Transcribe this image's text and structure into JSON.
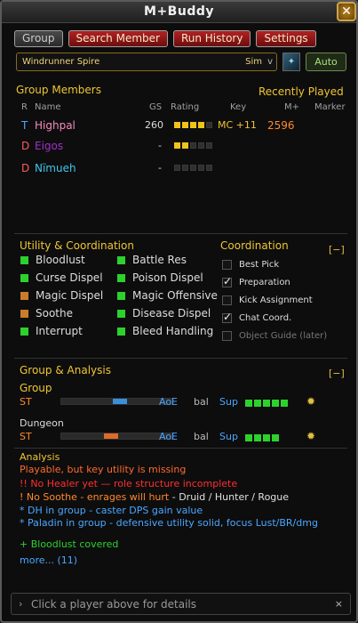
{
  "window": {
    "title": "M+Buddy",
    "close_icon": "close-icon"
  },
  "tabs": [
    {
      "label": "Group",
      "active": true
    },
    {
      "label": "Search Member",
      "active": false
    },
    {
      "label": "Run History",
      "active": false
    },
    {
      "label": "Settings",
      "active": false
    }
  ],
  "dungeon": {
    "selected": "Windrunner Spire",
    "sim": "Sim",
    "auto_label": "Auto"
  },
  "group_members": {
    "title": "Group Members",
    "recent_label": "Recently Played",
    "columns": {
      "r": "R",
      "name": "Name",
      "gs": "GS",
      "rating": "Rating",
      "key": "Key",
      "mplus": "M+",
      "marker": "Marker"
    },
    "rows": [
      {
        "role": "T",
        "name": "Highpal",
        "gs": "260",
        "rating": 4,
        "key": "MC +11",
        "mplus": "2596",
        "role_color": "#4fa3ff",
        "name_color": "#f48cba"
      },
      {
        "role": "D",
        "name": "Eigos",
        "gs": "-",
        "rating": 2,
        "key": "",
        "mplus": "",
        "role_color": "#ff5a5a",
        "name_color": "#a330c9"
      },
      {
        "role": "D",
        "name": "Nïmueh",
        "gs": "-",
        "rating": 0,
        "key": "",
        "mplus": "",
        "role_color": "#ff5a5a",
        "name_color": "#3fc7eb"
      }
    ]
  },
  "utility": {
    "title": "Utility & Coordination",
    "left": [
      {
        "label": "Bloodlust",
        "status": "#2dd12d"
      },
      {
        "label": "Curse Dispel",
        "status": "#2dd12d"
      },
      {
        "label": "Magic Dispel",
        "status": "#c87d2a"
      },
      {
        "label": "Soothe",
        "status": "#c87d2a"
      },
      {
        "label": "Interrupt",
        "status": "#2dd12d"
      }
    ],
    "right": [
      {
        "label": "Battle Res",
        "status": "#2dd12d"
      },
      {
        "label": "Poison Dispel",
        "status": "#2dd12d"
      },
      {
        "label": "Magic Offensive",
        "status": "#2dd12d"
      },
      {
        "label": "Disease Dispel",
        "status": "#2dd12d"
      },
      {
        "label": "Bleed Handling",
        "status": "#2dd12d"
      }
    ]
  },
  "coordination": {
    "title": "Coordination",
    "collapse": "[−]",
    "items": [
      {
        "label": "Best Pick",
        "checked": false,
        "dim": false
      },
      {
        "label": "Preparation",
        "checked": true,
        "dim": false
      },
      {
        "label": "Kick Assignment",
        "checked": false,
        "dim": false
      },
      {
        "label": "Chat Coord.",
        "checked": true,
        "dim": false
      },
      {
        "label": "Object Guide (later)",
        "checked": false,
        "dim": true
      }
    ]
  },
  "group_analysis": {
    "title": "Group & Analysis",
    "collapse": "[−]",
    "group": {
      "label": "Group",
      "st": "ST",
      "aoe": "AoE",
      "bal": "bal",
      "sup": "Sup",
      "support_count": 5,
      "balance": 0.53,
      "marker_color": "#3b8fd8"
    },
    "dungeon": {
      "label": "Dungeon",
      "st": "ST",
      "aoe": "AoE",
      "bal": "bal",
      "sup": "Sup",
      "support_count": 4,
      "balance": 0.45,
      "marker_color": "#e06a2a"
    }
  },
  "analysis": {
    "title": "Analysis",
    "lines": [
      {
        "text": "Playable, but key utility is missing",
        "color": "#ff6a2a"
      },
      {
        "text": "!! No Healer yet — role structure incomplete",
        "color": "#ff2f2f"
      },
      {
        "text": "! No Soothe - enrages will hurt",
        "extra": "  - Druid / Hunter / Rogue",
        "color": "#ff8a2a",
        "extra_color": "#e0e0e0"
      },
      {
        "text": "* DH in group - caster DPS gain value",
        "color": "#4aa7ff"
      },
      {
        "text": "* Paladin in group - defensive utility solid, focus Lust/BR/dmg",
        "color": "#4aa7ff"
      },
      {
        "text": "+ Bloodlust covered",
        "color": "#2dd12d"
      },
      {
        "text": "more... (11)",
        "color": "#4aa7ff"
      }
    ]
  },
  "footer": {
    "text": "Click a player above for details",
    "arrow": "›",
    "close": "×"
  }
}
